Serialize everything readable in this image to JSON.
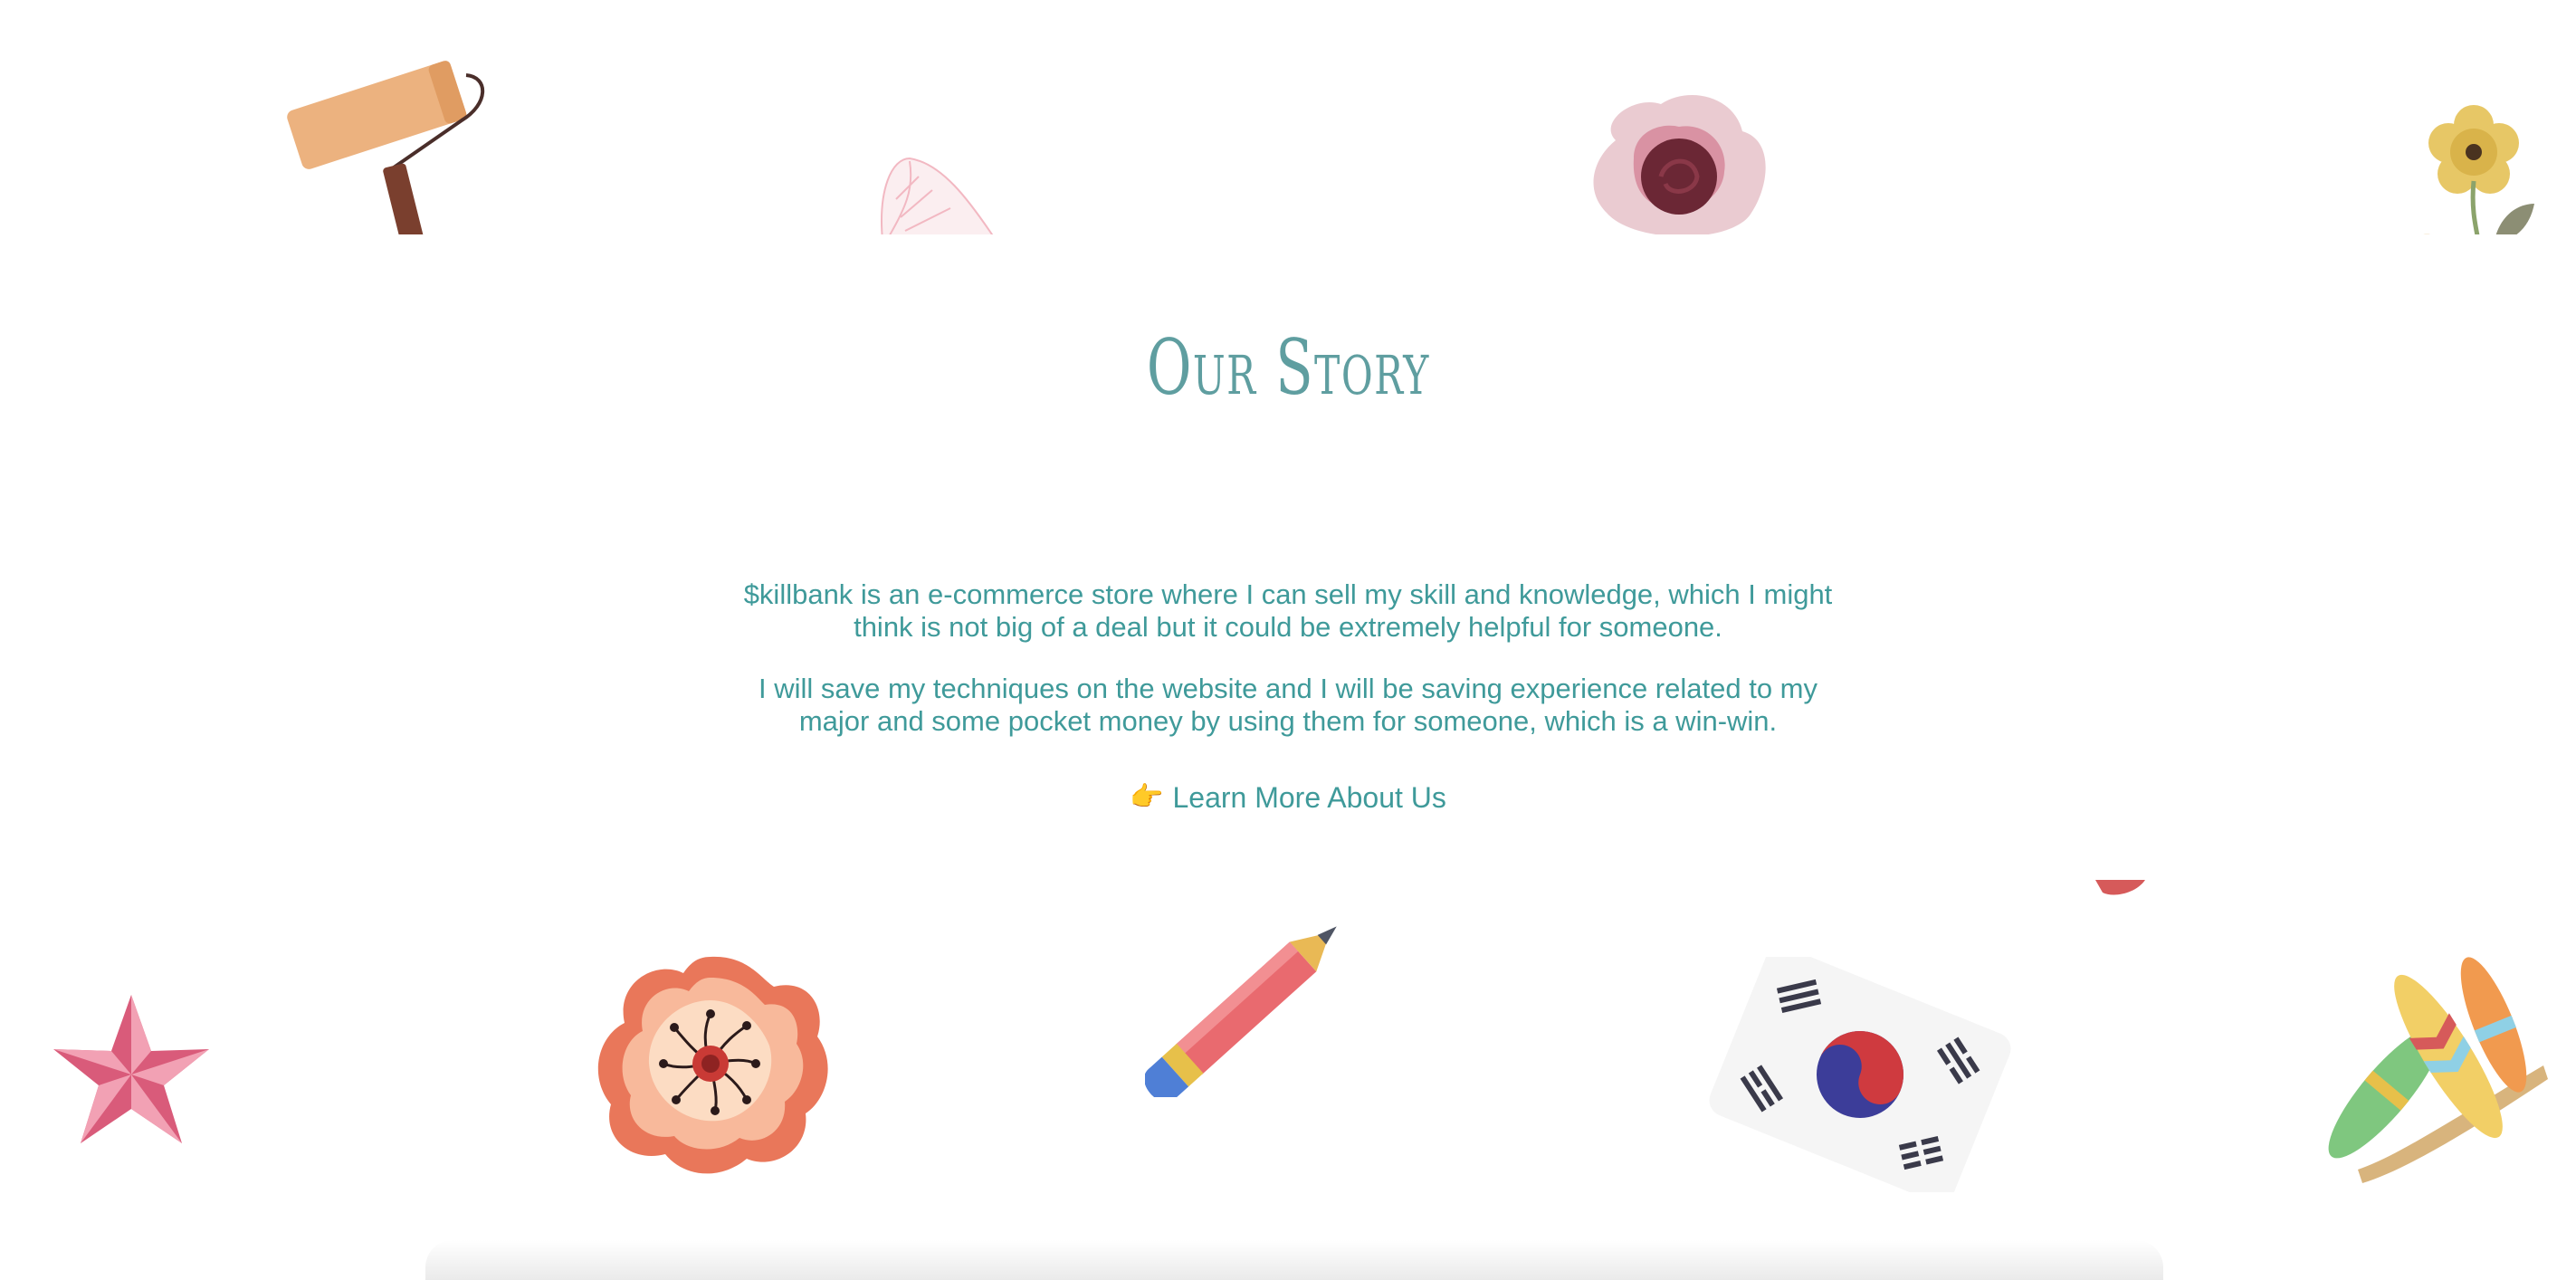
{
  "story": {
    "title": "Our Story",
    "paragraph_1": "$killbank is an e-commerce store where I can sell my skill and knowledge, which I might think is not big of a deal but it could be extremely helpful for someone.",
    "paragraph_2": "I will save my techniques on the website and I will be saving experience related to my major and some pocket money by using them for someone, which is a win-win.",
    "learn_more_icon": "👉",
    "learn_more_label": "Learn More About Us"
  },
  "decorations": {
    "top": [
      "paint-roller-icon",
      "leaf-icon",
      "rose-icon",
      "yellow-flower-icon"
    ],
    "bottom": [
      "star-icon",
      "flower-icon",
      "pencil-icon",
      "korean-flag-icon",
      "surfboards-icon"
    ]
  },
  "colors": {
    "accent": "#5f9ea0",
    "text": "#3f9a9a",
    "background": "#ffffff"
  }
}
